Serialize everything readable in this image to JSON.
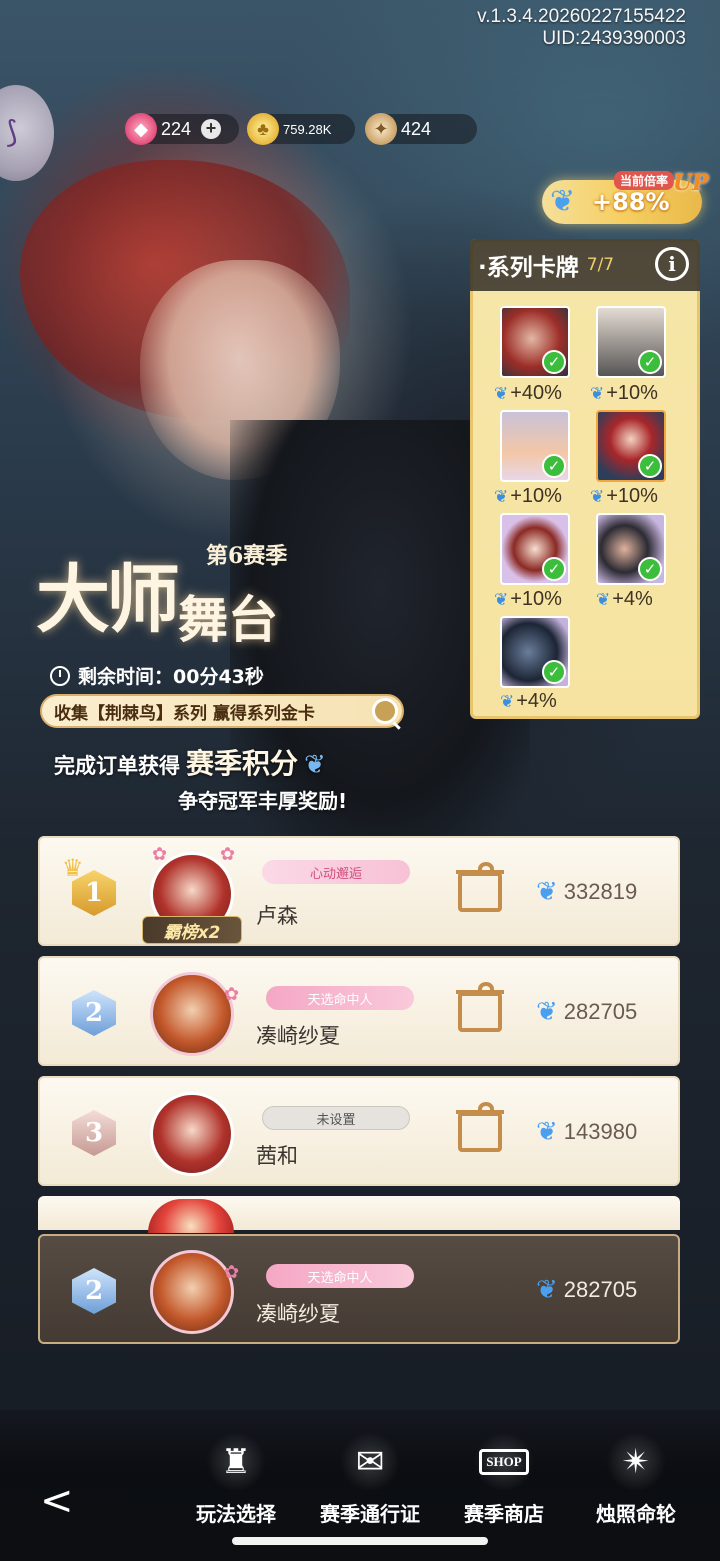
{
  "header": {
    "version": "v.1.3.4.20260227155422",
    "uid": "UID:2439390003"
  },
  "currency": {
    "diamond": "224",
    "coin": "759.28K",
    "star": "424",
    "plus": "+"
  },
  "multiplier": {
    "tag": "当前倍率",
    "up": "UP",
    "value": "+88%"
  },
  "series_panel": {
    "title": "·系列卡牌",
    "count": "7/7",
    "info": "i",
    "cards": [
      {
        "bonus": "+40%"
      },
      {
        "bonus": "+10%"
      },
      {
        "bonus": "+10%"
      },
      {
        "bonus": "+10%"
      },
      {
        "bonus": "+10%"
      },
      {
        "bonus": "+4%"
      },
      {
        "bonus": "+4%"
      }
    ]
  },
  "season": {
    "title_line1": "大师",
    "title_line2": "舞台",
    "season_no": "第6赛季",
    "timer": "剩余时间：00分43秒",
    "collect": "收集【荆棘鸟】系列 赢得系列金卡",
    "order_prefix": "完成订单获得",
    "order_big": "赛季积分",
    "compete": "争夺冠军丰厚奖励!"
  },
  "ranking": [
    {
      "rank": "1",
      "badge": "心动邂逅",
      "name": "卢森",
      "score": "332819",
      "extra": "霸榜x2"
    },
    {
      "rank": "2",
      "badge": "天选命中人",
      "name": "凑崎纱夏",
      "score": "282705"
    },
    {
      "rank": "3",
      "badge": "未设置",
      "name": "茜和",
      "score": "143980"
    }
  ],
  "my_rank": {
    "rank": "2",
    "badge": "天选命中人",
    "name": "凑崎纱夏",
    "score": "282705"
  },
  "nav": {
    "back": "<",
    "items": [
      {
        "label": "玩法选择"
      },
      {
        "label": "赛季通行证"
      },
      {
        "label": "赛季商店",
        "sign": "SHOP"
      },
      {
        "label": "烛照命轮"
      }
    ]
  }
}
